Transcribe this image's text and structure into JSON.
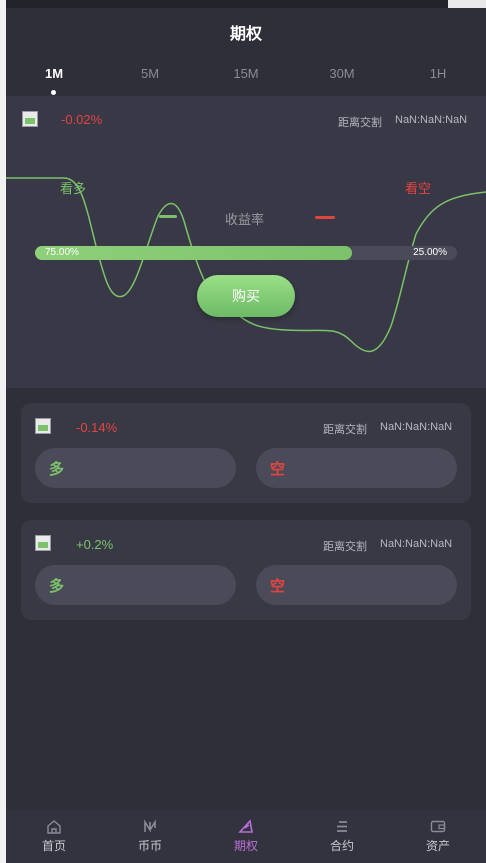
{
  "header": {
    "title": "期权"
  },
  "tabs": [
    {
      "label": "1M",
      "active": true
    },
    {
      "label": "5M",
      "active": false
    },
    {
      "label": "15M",
      "active": false
    },
    {
      "label": "30M",
      "active": false
    },
    {
      "label": "1H",
      "active": false
    }
  ],
  "main_card": {
    "change": "-0.02%",
    "countdown_label": "距离交割",
    "countdown_value": "NaN:NaN:NaN",
    "bull_label": "看多",
    "bear_label": "看空",
    "yield_label": "收益率",
    "progress": {
      "long_fraction": 0.75,
      "long_text": "75.00%",
      "short_text": "25.00%"
    },
    "buy_label": "购买"
  },
  "cards": [
    {
      "change": "-0.14%",
      "change_color": "#e2453f",
      "countdown_label": "距离交割",
      "countdown_value": "NaN:NaN:NaN",
      "long_label": "多",
      "short_label": "空"
    },
    {
      "change": "+0.2%",
      "change_color": "#7cc26b",
      "countdown_label": "距离交割",
      "countdown_value": "NaN:NaN:NaN",
      "long_label": "多",
      "short_label": "空"
    }
  ],
  "nav": [
    {
      "label": "首页",
      "icon": "home-icon",
      "active": false
    },
    {
      "label": "币币",
      "icon": "coin-icon",
      "active": false
    },
    {
      "label": "期权",
      "icon": "option-icon",
      "active": true
    },
    {
      "label": "合约",
      "icon": "contract-icon",
      "active": false
    },
    {
      "label": "资产",
      "icon": "wallet-icon",
      "active": false
    }
  ],
  "colors": {
    "up": "#7cc26b",
    "down": "#e2453f",
    "active_nav": "#b86fd6",
    "background": "#2f2f3a"
  }
}
